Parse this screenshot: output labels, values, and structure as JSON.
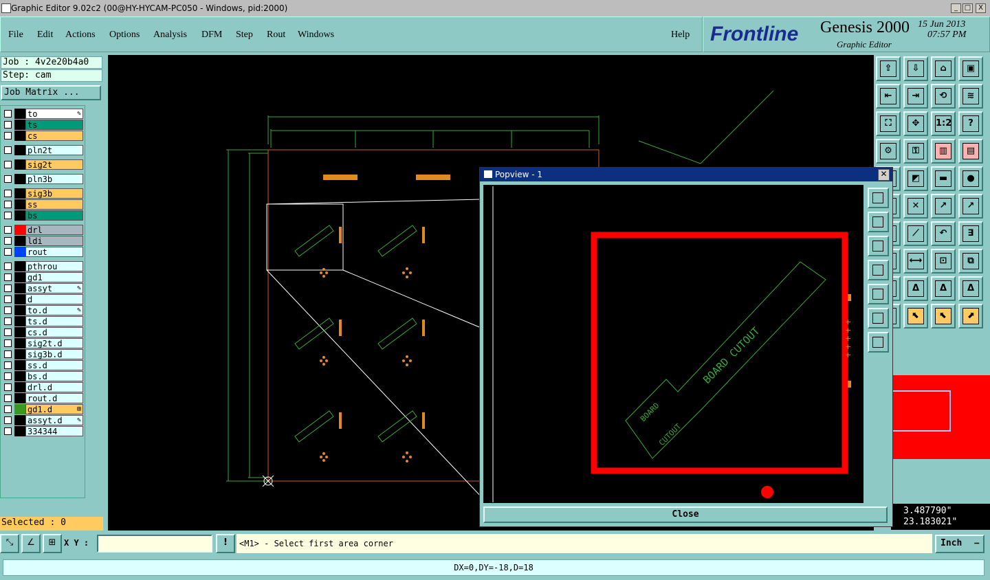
{
  "window": {
    "title": "Graphic Editor 9.02c2 (00@HY-HYCAM-PC050 - Windows, pid:2000)",
    "buttons": [
      "_",
      "□",
      "X"
    ]
  },
  "menu": {
    "items": [
      "File",
      "Edit",
      "Actions",
      "Options",
      "Analysis",
      "DFM",
      "Step",
      "Rout",
      "Windows"
    ],
    "help": "Help"
  },
  "brand": {
    "logo": "Frontline",
    "product": "Genesis 2000",
    "subtitle": "Graphic Editor",
    "date": "15 Jun 2013",
    "time": "07:57 PM"
  },
  "job": {
    "job_line": "Job : 4v2e20b4a0",
    "step_line": "Step: cam",
    "matrix_button": "Job Matrix ..."
  },
  "layers": [
    {
      "name": "to",
      "bg": "#ffffff",
      "swatch": "#000000",
      "mark": "✎"
    },
    {
      "name": "ts",
      "bg": "#009a78",
      "swatch": "#000000",
      "mark": ""
    },
    {
      "name": "cs",
      "bg": "#ffca60",
      "swatch": "#000000",
      "mark": ""
    },
    {
      "name": "pln2t",
      "bg": "#dcffff",
      "swatch": "#000000",
      "mark": ""
    },
    {
      "name": "sig2t",
      "bg": "#ffca60",
      "swatch": "#000000",
      "mark": ""
    },
    {
      "name": "pln3b",
      "bg": "#dcffff",
      "swatch": "#000000",
      "mark": ""
    },
    {
      "name": "sig3b",
      "bg": "#ffca60",
      "swatch": "#000000",
      "mark": ""
    },
    {
      "name": "ss",
      "bg": "#ffca60",
      "swatch": "#000000",
      "mark": ""
    },
    {
      "name": "bs",
      "bg": "#009a78",
      "swatch": "#000000",
      "mark": ""
    },
    {
      "name": "drl",
      "bg": "#aab6bf",
      "swatch": "#ff0000",
      "mark": ""
    },
    {
      "name": "ldi",
      "bg": "#aab6bf",
      "swatch": "#000000",
      "mark": ""
    },
    {
      "name": "rout",
      "bg": "#dcffff",
      "swatch": "#0040ff",
      "mark": ""
    },
    {
      "name": "pthrou",
      "bg": "#dcffff",
      "swatch": "#000000",
      "mark": ""
    },
    {
      "name": "gd1",
      "bg": "#dcffff",
      "swatch": "#000000",
      "mark": ""
    },
    {
      "name": "assyt",
      "bg": "#dcffff",
      "swatch": "#000000",
      "mark": "✎"
    },
    {
      "name": "d",
      "bg": "#dcffff",
      "swatch": "#000000",
      "mark": ""
    },
    {
      "name": "to.d",
      "bg": "#dcffff",
      "swatch": "#000000",
      "mark": "✎"
    },
    {
      "name": "ts.d",
      "bg": "#dcffff",
      "swatch": "#000000",
      "mark": ""
    },
    {
      "name": "cs.d",
      "bg": "#dcffff",
      "swatch": "#000000",
      "mark": ""
    },
    {
      "name": "sig2t.d",
      "bg": "#dcffff",
      "swatch": "#000000",
      "mark": ""
    },
    {
      "name": "sig3b.d",
      "bg": "#dcffff",
      "swatch": "#000000",
      "mark": ""
    },
    {
      "name": "ss.d",
      "bg": "#dcffff",
      "swatch": "#000000",
      "mark": ""
    },
    {
      "name": "bs.d",
      "bg": "#dcffff",
      "swatch": "#000000",
      "mark": ""
    },
    {
      "name": "drl.d",
      "bg": "#dcffff",
      "swatch": "#000000",
      "mark": ""
    },
    {
      "name": "rout.d",
      "bg": "#dcffff",
      "swatch": "#000000",
      "mark": ""
    },
    {
      "name": "gd1.d",
      "bg": "#ffca60",
      "swatch": "#3a9a20",
      "mark": "⊞"
    },
    {
      "name": "assyt.d",
      "bg": "#dcffff",
      "swatch": "#000000",
      "mark": "✎"
    },
    {
      "name": "334344",
      "bg": "#dcffff",
      "swatch": "#000000",
      "mark": ""
    }
  ],
  "selected_label": "Selected : 0",
  "popview": {
    "title": "Popview - 1",
    "close_button": "Close",
    "board_text_1": "BOARD CUTOUT",
    "board_text_2": "BOARD",
    "board_text_3": "CUTOUT"
  },
  "coords": {
    "x": "3.487790\"",
    "y": "23.183021\""
  },
  "command": {
    "xy_label": "X Y :",
    "xy_value": "",
    "alert_icon": "!",
    "prompt": "<M1> - Select first area corner",
    "unit": "Inch"
  },
  "status": "DX=0,DY=-18,D=18",
  "tool_icons": [
    "zoom-home-icon",
    "zoom-back-icon",
    "home-icon",
    "zoom-window-icon",
    "pan-left-icon",
    "pan-right-icon",
    "step-repeat-icon",
    "snap-icon",
    "fit-icon",
    "zoom-fit-icon",
    "scale-1-2-icon",
    "query-icon",
    "measure-icon",
    "key-icon",
    "layers-toggle-icon",
    "layers-compare-icon"
  ],
  "colors": {
    "teal": "#8ec9c6",
    "canvas": "#000000",
    "outline": "#d05a2a",
    "feature": "#e08a20",
    "dim": "#3aa83a",
    "popview_frame": "#ff0000"
  }
}
